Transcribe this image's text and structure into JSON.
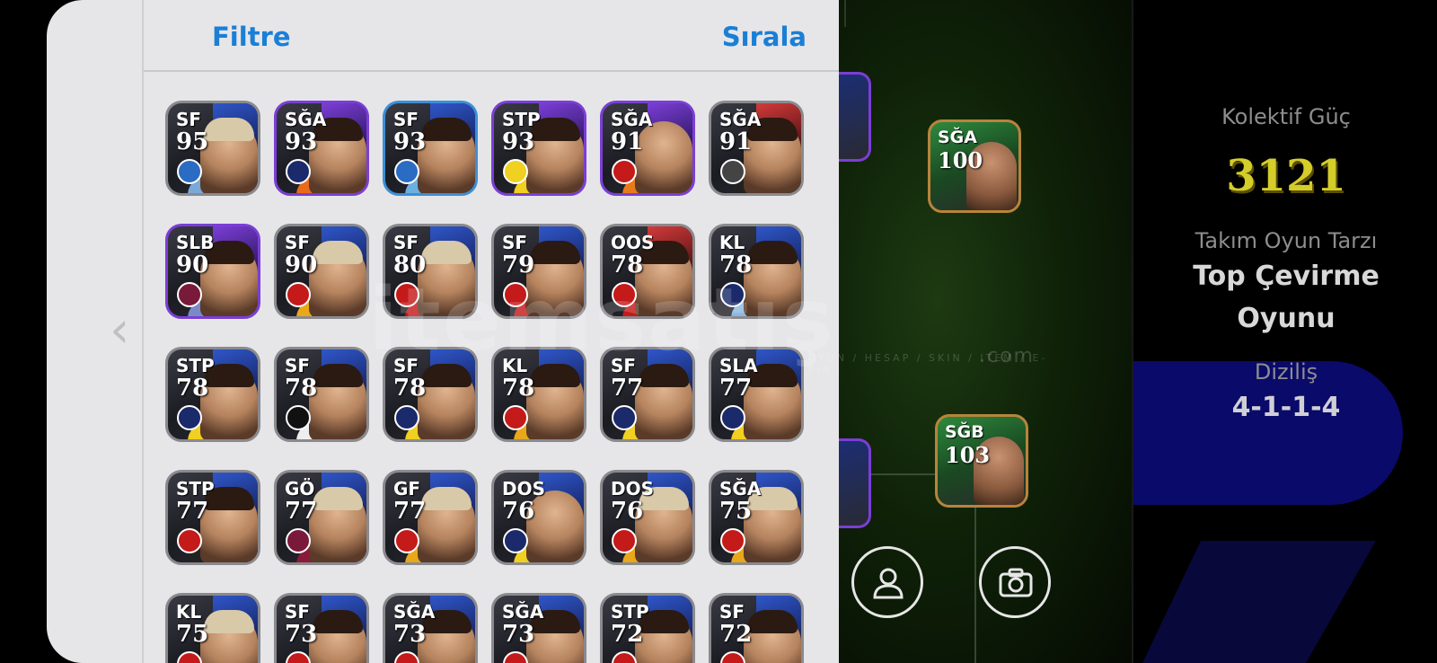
{
  "header": {
    "filter_label": "Filtre",
    "sort_label": "Sırala"
  },
  "info": {
    "power_label": "Kolektif Güç",
    "power_value": "3121",
    "style_label": "Takım Oyun Tarzı",
    "style_value_line1": "Top Çevirme",
    "style_value_line2": "Oyunu",
    "formation_label": "Diziliş",
    "formation_value": "4-1-1-4"
  },
  "watermark": {
    "main": "itemsatış",
    "sub": "OYUN / HESAP / SKIN / ITEM / E-PIN",
    "domain": ".com"
  },
  "players": [
    {
      "pos": "SF",
      "ovr": "95",
      "border": "gray",
      "accent": "purple",
      "badge": "#2a6cc4",
      "jersey": "#7aa8d8",
      "hair": "blond"
    },
    {
      "pos": "SĞA",
      "ovr": "93",
      "border": "purple",
      "accent": "purple",
      "badge": "#1a2a6a",
      "jersey": "#e86a1a",
      "hair": "dark"
    },
    {
      "pos": "SF",
      "ovr": "93",
      "border": "blue",
      "accent": "blue",
      "badge": "#2a6cc4",
      "jersey": "#6ab0e0",
      "hair": "dark"
    },
    {
      "pos": "STP",
      "ovr": "93",
      "border": "purple",
      "accent": "purple",
      "badge": "#f0d020",
      "jersey": "#f0d020",
      "hair": "dark"
    },
    {
      "pos": "SĞA",
      "ovr": "91",
      "border": "purple",
      "accent": "purple",
      "badge": "#c41a1a",
      "jersey": "#e87a1a",
      "hair": "bald"
    },
    {
      "pos": "SĞA",
      "ovr": "91",
      "border": "gray",
      "accent": "red",
      "badge": "#444444",
      "jersey": "#222222",
      "hair": "dark"
    },
    {
      "pos": "SLB",
      "ovr": "90",
      "border": "purple",
      "accent": "purple",
      "badge": "#7a1a3a",
      "jersey": "#7a8ac8",
      "hair": "dark"
    },
    {
      "pos": "SF",
      "ovr": "90",
      "border": "gray",
      "accent": "blue",
      "badge": "#c41a1a",
      "jersey": "#e8a81a",
      "hair": "blond"
    },
    {
      "pos": "SF",
      "ovr": "80",
      "border": "gray",
      "accent": "blue",
      "badge": "#c41a1a",
      "jersey": "#c41a1a",
      "hair": "blond"
    },
    {
      "pos": "SF",
      "ovr": "79",
      "border": "gray",
      "accent": "blue",
      "badge": "#c41a1a",
      "jersey": "#c41a1a",
      "hair": "dark"
    },
    {
      "pos": "OOS",
      "ovr": "78",
      "border": "gray",
      "accent": "red",
      "badge": "#c41a1a",
      "jersey": "#c41a1a",
      "hair": "dark"
    },
    {
      "pos": "KL",
      "ovr": "78",
      "border": "gray",
      "accent": "blue",
      "badge": "#1a2a6a",
      "jersey": "#8ab8e0",
      "hair": "dark"
    },
    {
      "pos": "STP",
      "ovr": "78",
      "border": "gray",
      "accent": "blue",
      "badge": "#1a2a6a",
      "jersey": "#f0d020",
      "hair": "dark"
    },
    {
      "pos": "SF",
      "ovr": "78",
      "border": "gray",
      "accent": "blue",
      "badge": "#111111",
      "jersey": "#eeeeee",
      "hair": "dark"
    },
    {
      "pos": "SF",
      "ovr": "78",
      "border": "gray",
      "accent": "blue",
      "badge": "#1a2a6a",
      "jersey": "#f0d020",
      "hair": "dark"
    },
    {
      "pos": "KL",
      "ovr": "78",
      "border": "gray",
      "accent": "blue",
      "badge": "#c41a1a",
      "jersey": "#e8a81a",
      "hair": "dark"
    },
    {
      "pos": "SF",
      "ovr": "77",
      "border": "gray",
      "accent": "blue",
      "badge": "#1a2a6a",
      "jersey": "#f0d020",
      "hair": "dark"
    },
    {
      "pos": "SLA",
      "ovr": "77",
      "border": "gray",
      "accent": "blue",
      "badge": "#1a2a6a",
      "jersey": "#f0d020",
      "hair": "dark"
    },
    {
      "pos": "STP",
      "ovr": "77",
      "border": "gray",
      "accent": "blue",
      "badge": "#c41a1a",
      "jersey": "#222222",
      "hair": "dark"
    },
    {
      "pos": "GÖ",
      "ovr": "77",
      "border": "gray",
      "accent": "purple",
      "badge": "#7a1a3a",
      "jersey": "#8a1a3a",
      "hair": "blond"
    },
    {
      "pos": "GF",
      "ovr": "77",
      "border": "gray",
      "accent": "blue",
      "badge": "#c41a1a",
      "jersey": "#e8a81a",
      "hair": "blond"
    },
    {
      "pos": "DOS",
      "ovr": "76",
      "border": "gray",
      "accent": "blue",
      "badge": "#1a2a6a",
      "jersey": "#f0d020",
      "hair": "bald"
    },
    {
      "pos": "DOS",
      "ovr": "76",
      "border": "gray",
      "accent": "blue",
      "badge": "#c41a1a",
      "jersey": "#e8a81a",
      "hair": "blond"
    },
    {
      "pos": "SĞA",
      "ovr": "75",
      "border": "gray",
      "accent": "blue",
      "badge": "#c41a1a",
      "jersey": "#e8a81a",
      "hair": "blond"
    },
    {
      "pos": "KL",
      "ovr": "75",
      "border": "gray",
      "accent": "blue",
      "badge": "#c41a1a",
      "jersey": "#444444",
      "hair": "blond"
    },
    {
      "pos": "SF",
      "ovr": "73",
      "border": "gray",
      "accent": "blue",
      "badge": "#c41a1a",
      "jersey": "#444444",
      "hair": "dark"
    },
    {
      "pos": "SĞA",
      "ovr": "73",
      "border": "gray",
      "accent": "blue",
      "badge": "#c41a1a",
      "jersey": "#444444",
      "hair": "dark"
    },
    {
      "pos": "SĞA",
      "ovr": "73",
      "border": "gray",
      "accent": "blue",
      "badge": "#c41a1a",
      "jersey": "#444444",
      "hair": "dark"
    },
    {
      "pos": "STP",
      "ovr": "72",
      "border": "gray",
      "accent": "blue",
      "badge": "#c41a1a",
      "jersey": "#444444",
      "hair": "dark"
    },
    {
      "pos": "SF",
      "ovr": "72",
      "border": "gray",
      "accent": "blue",
      "badge": "#c41a1a",
      "jersey": "#444444",
      "hair": "dark"
    }
  ],
  "pitch_players": [
    {
      "pos": "SĞA",
      "ovr": "100"
    },
    {
      "pos": "SĞB",
      "ovr": "103"
    }
  ],
  "colors": {
    "accent": "#1a7fd6",
    "power": "#d4cd2a",
    "purple_border": "#7b3ed6"
  }
}
